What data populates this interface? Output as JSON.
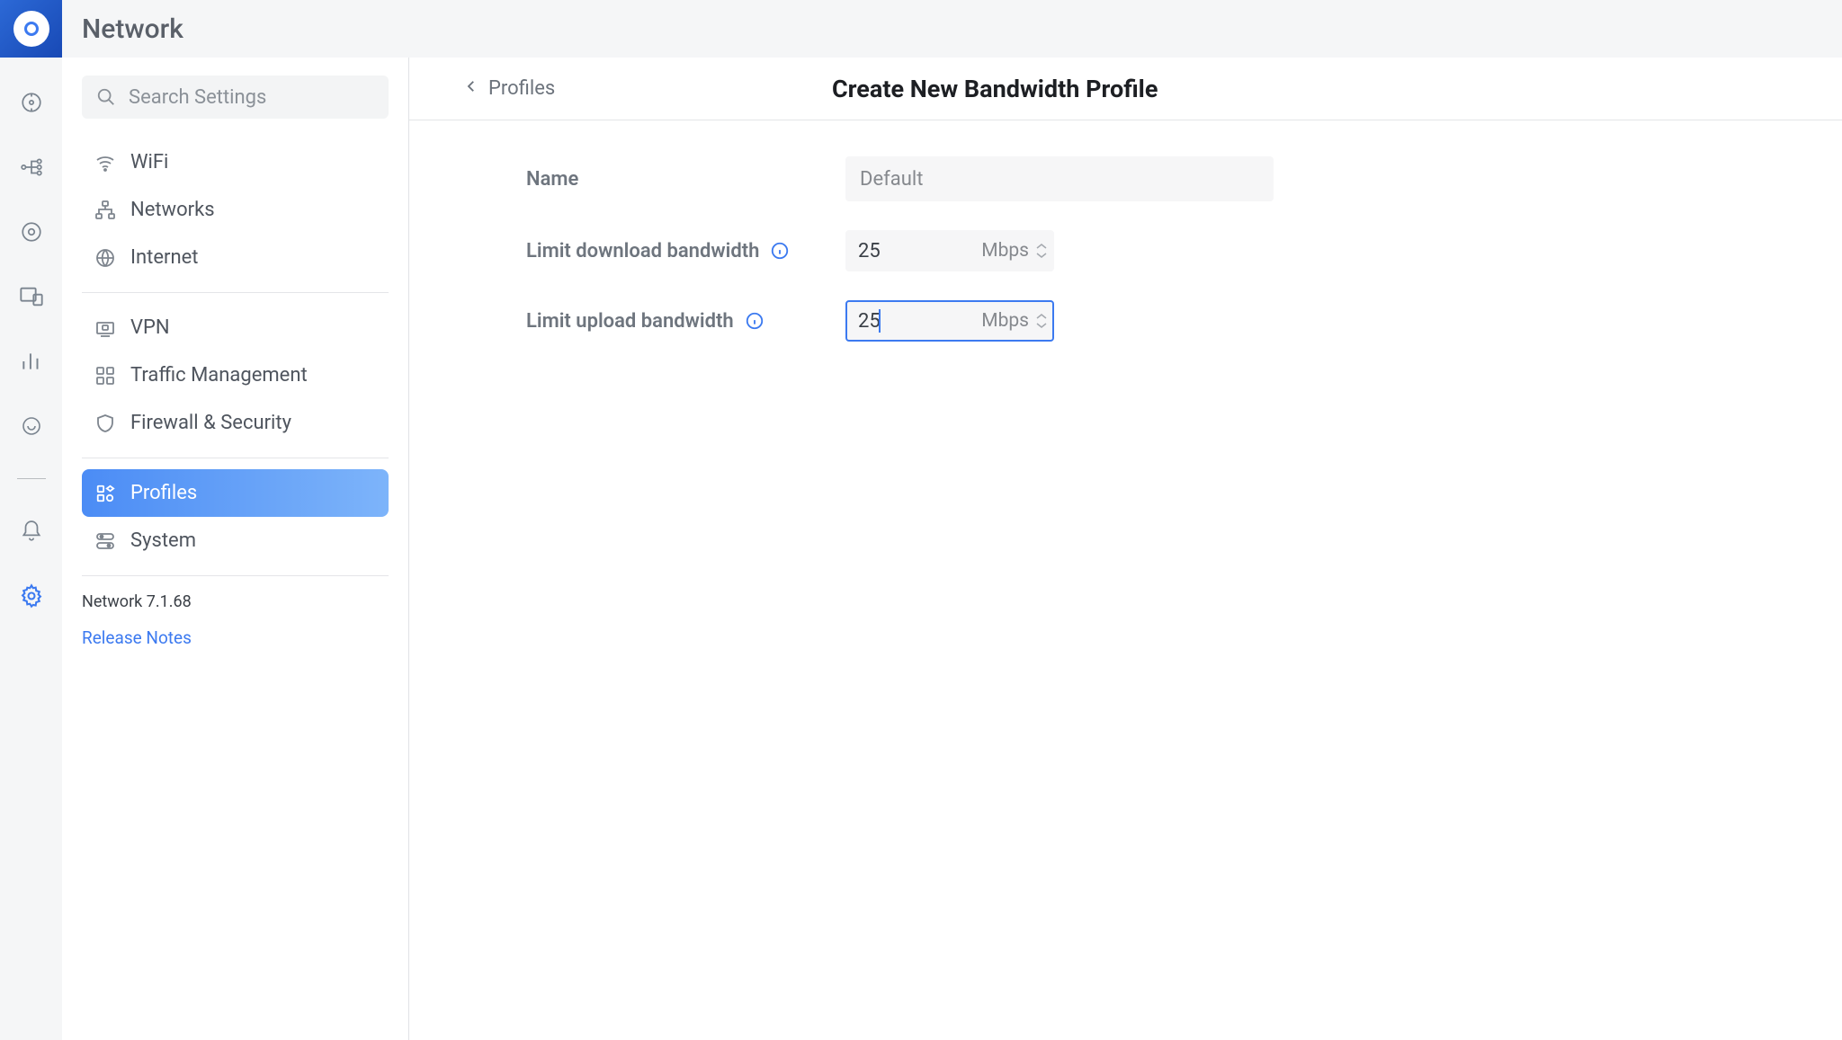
{
  "header": {
    "title": "Network"
  },
  "search": {
    "placeholder": "Search Settings"
  },
  "sidebar": {
    "group1": [
      {
        "label": "WiFi"
      },
      {
        "label": "Networks"
      },
      {
        "label": "Internet"
      }
    ],
    "group2": [
      {
        "label": "VPN"
      },
      {
        "label": "Traffic Management"
      },
      {
        "label": "Firewall & Security"
      }
    ],
    "group3": [
      {
        "label": "Profiles"
      },
      {
        "label": "System"
      }
    ],
    "version": "Network 7.1.68",
    "release_notes": "Release Notes"
  },
  "panel": {
    "back_label": "Profiles",
    "title": "Create New Bandwidth Profile"
  },
  "form": {
    "name_label": "Name",
    "name_placeholder": "Default",
    "download_label": "Limit download bandwidth",
    "download_value": "25",
    "download_unit": "Mbps",
    "upload_label": "Limit upload bandwidth",
    "upload_value": "25",
    "upload_unit": "Mbps"
  }
}
